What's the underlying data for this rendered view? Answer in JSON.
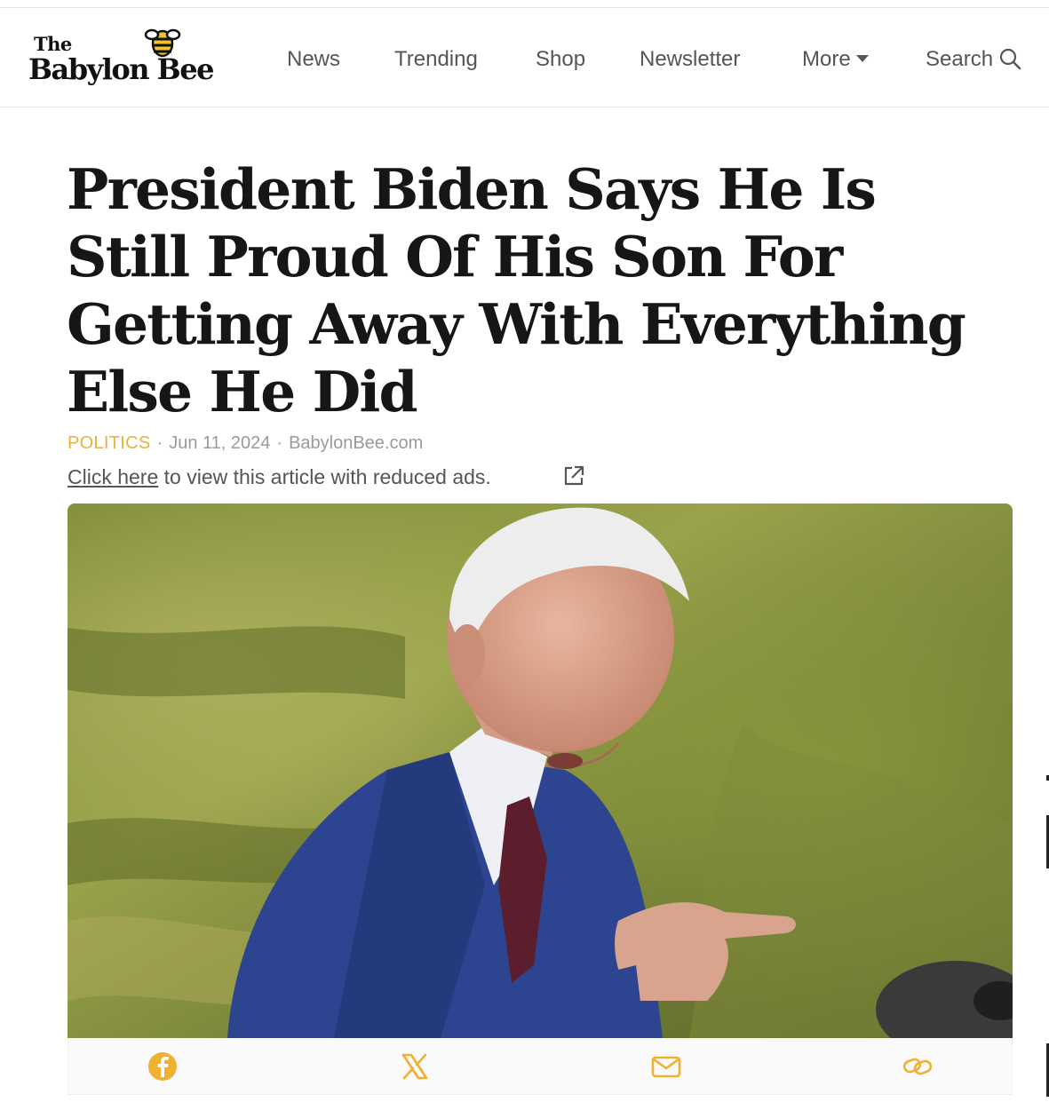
{
  "header": {
    "logo_the": "The",
    "logo_main": "Babylon Bee",
    "nav": {
      "news": "News",
      "trending": "Trending",
      "shop": "Shop",
      "newsletter": "Newsletter",
      "more": "More",
      "search": "Search"
    }
  },
  "article": {
    "headline": "President Biden Says He Is Still Proud Of His Son For Getting Away With Everything Else He Did",
    "category": "POLITICS",
    "date": "Jun 11, 2024",
    "source": "BabylonBee.com",
    "meta_sep": "·",
    "reduced_ads_link": "Click here",
    "reduced_ads_text": " to view this article with reduced ads."
  },
  "share": {
    "icons": [
      "facebook-icon",
      "x-icon",
      "mail-icon",
      "link-icon"
    ]
  },
  "colors": {
    "accent": "#e8b13a",
    "headline": "#161616",
    "nav_text": "#555555",
    "meta_text": "#9a9a9a"
  }
}
